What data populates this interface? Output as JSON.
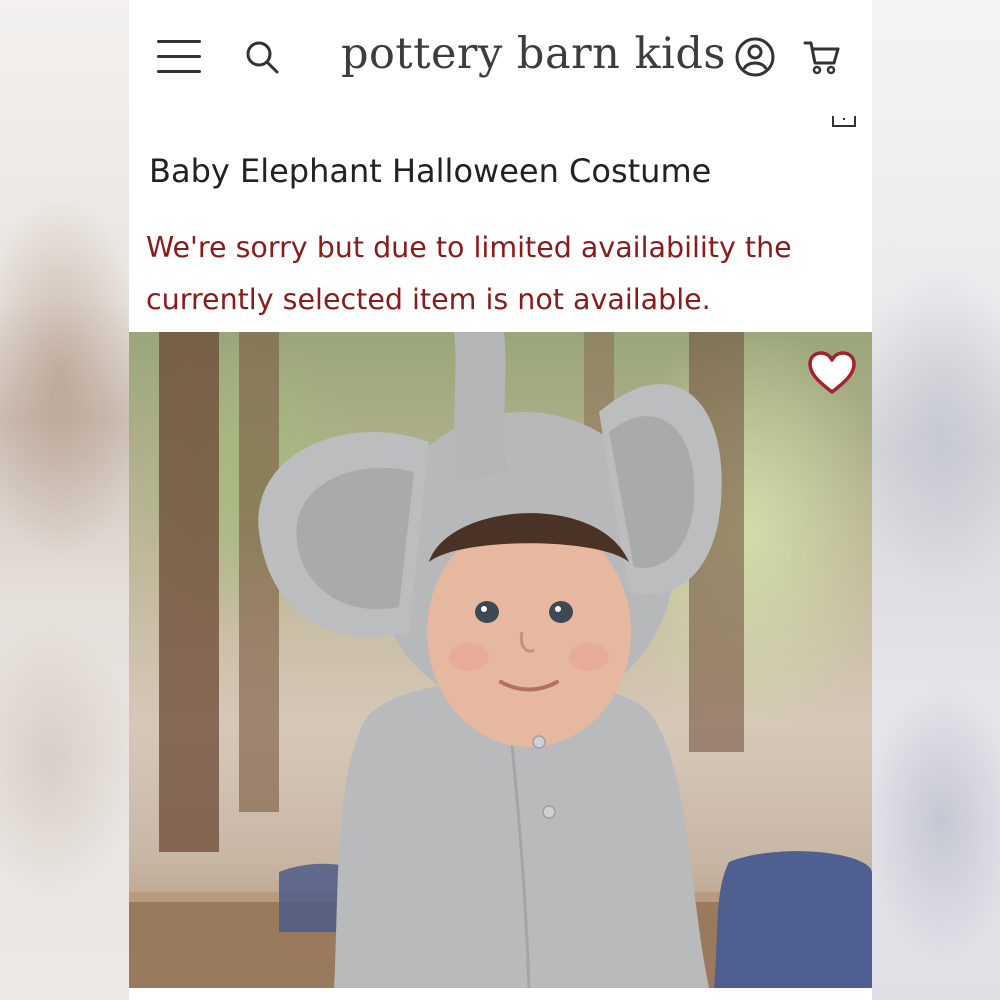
{
  "header": {
    "brand": "pottery barn kids",
    "menu_icon": "hamburger-menu-icon",
    "search_icon": "search-icon",
    "account_icon": "account-icon",
    "cart_icon": "cart-icon"
  },
  "product": {
    "title": "Baby Elephant Halloween Costume",
    "availability_message": "We're sorry but due to limited availability the currently selected item is not available.",
    "image_alt": "Baby wearing a gray elephant costume with large ears and trunk hood",
    "favorite_icon": "heart-icon"
  },
  "colors": {
    "alert_text": "#8b1a1a",
    "favorite_heart": "#a3222e",
    "costume_gray": "#b9babb"
  }
}
